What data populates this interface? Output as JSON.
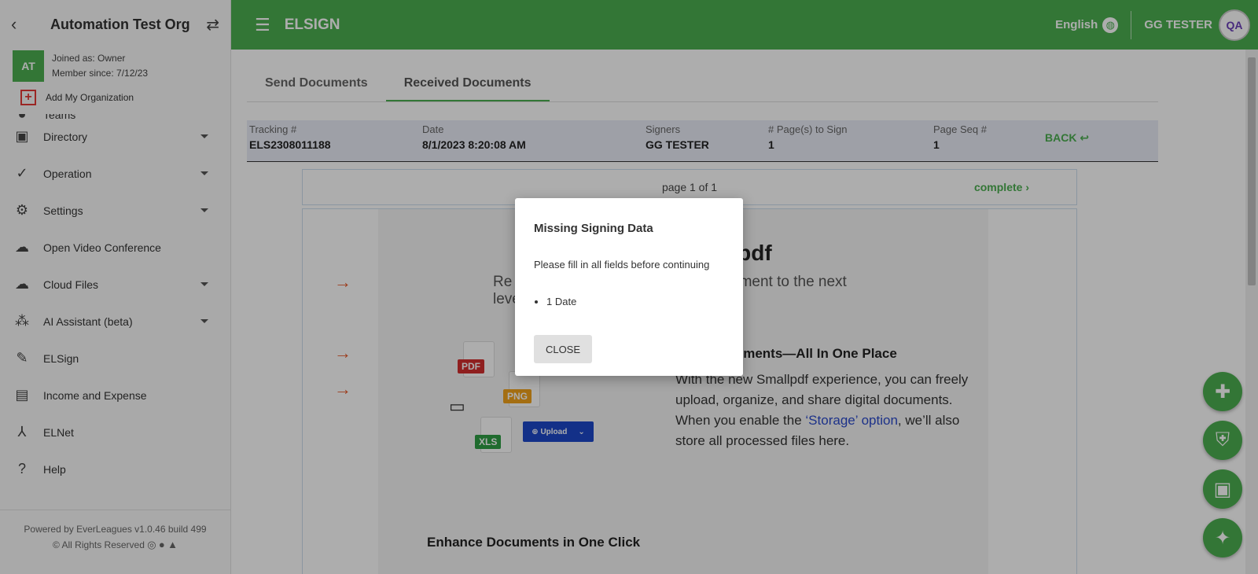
{
  "sidebar": {
    "org_name": "Automation Test Org",
    "avatar_initials": "AT",
    "joined_as": "Joined as: Owner",
    "member_since": "Member since: 7/12/23",
    "add_org_label": "Add My Organization",
    "partial_item": "Teams",
    "items": [
      {
        "label": "Directory",
        "icon": "id-card-icon",
        "glyph": "▣"
      },
      {
        "label": "Operation",
        "icon": "clipboard-check-icon",
        "glyph": "✓"
      },
      {
        "label": "Settings",
        "icon": "gear-icon",
        "glyph": "⚙"
      },
      {
        "label": "Open Video Conference",
        "icon": "video-cloud-icon",
        "glyph": "☁"
      },
      {
        "label": "Cloud Files",
        "icon": "cloud-icon",
        "glyph": "☁"
      },
      {
        "label": "AI Assistant (beta)",
        "icon": "ai-nodes-icon",
        "glyph": "⁂"
      },
      {
        "label": "ELSign",
        "icon": "pencil-icon",
        "glyph": "✎"
      },
      {
        "label": "Income and Expense",
        "icon": "wallet-icon",
        "glyph": "▤"
      },
      {
        "label": "ELNet",
        "icon": "network-icon",
        "glyph": "⅄"
      },
      {
        "label": "Help",
        "icon": "help-icon",
        "glyph": "?"
      }
    ],
    "footer_powered": "Powered by EverLeagues v1.0.46 build 499",
    "footer_rights": "© All Rights Reserved"
  },
  "topbar": {
    "app_title": "ELSIGN",
    "language": "English",
    "user_name": "GG TESTER",
    "user_avatar": "QA"
  },
  "tabs": [
    {
      "label": "Send Documents"
    },
    {
      "label": "Received Documents"
    }
  ],
  "info": {
    "tracking_label": "Tracking #",
    "tracking_value": "ELS2308011188",
    "date_label": "Date",
    "date_value": "8/1/2023 8:20:08 AM",
    "signers_label": "Signers",
    "signers_value": "GG TESTER",
    "pages_label": "# Page(s) to Sign",
    "pages_value": "1",
    "seq_label": "Page Seq #",
    "seq_value": "1",
    "back_label": "BACK"
  },
  "pager": {
    "text": "page 1 of 1",
    "complete": "complete"
  },
  "document": {
    "heading": "allpdf",
    "subheading_left": "Re",
    "subheading_right": "ment to the next level?",
    "section_title": "ocuments—All In One Place",
    "body_1": "With the new Smallpdf experience, you can freely upload, organize, and share digital documents. When you enable the ",
    "body_link": "‘Storage’ option",
    "body_2": ", we’ll also store all processed files here.",
    "enhance_title": "Enhance Documents in One Click",
    "badge_pdf": "PDF",
    "badge_png": "PNG",
    "badge_xls": "XLS",
    "upload_label": "Upload"
  },
  "modal": {
    "title": "Missing Signing Data",
    "message": "Please fill in all fields before continuing",
    "missing_items": [
      "1 Date"
    ],
    "close_label": "CLOSE"
  },
  "colors": {
    "brand_green": "#4caf50",
    "link_blue": "#2b4acb",
    "arrow_orange": "#e85a2c"
  }
}
